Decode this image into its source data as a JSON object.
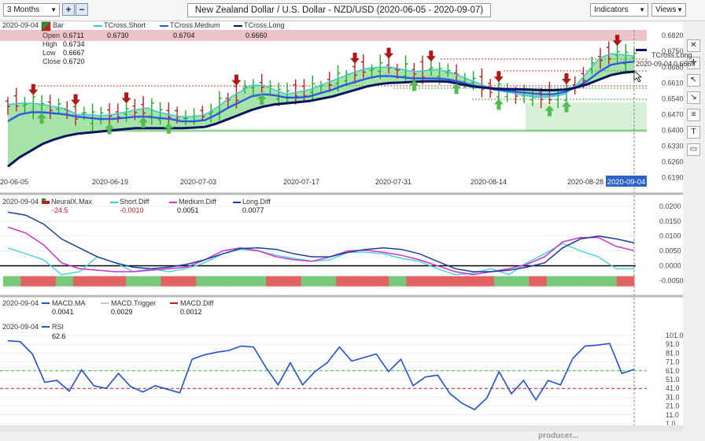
{
  "toolbar": {
    "period": "3 Months",
    "add_label": "+",
    "remove_label": "−",
    "title": "New Zealand Dollar / U.S. Dollar - NZD/USD (2020-06-05 - 2020-09-07)",
    "indicators_label": "Indicators",
    "views_label": "Views"
  },
  "colors": {
    "bull": "#22aa22",
    "bear": "#c02020",
    "short": "#3cc7d7",
    "medium": "#2a55e0",
    "long": "#0a1560",
    "macd_trigger": "#c8c8c8",
    "macd_diff": "#c02020",
    "rsi": "#2050d0",
    "rsi_upper": "#33bb33",
    "rsi_lower": "#cc2222",
    "zero": "#000000",
    "neural_pos": "#72c472",
    "neural_neg": "#e05a5a"
  },
  "price_panel": {
    "date": "2020-09-04",
    "bar_label": "Bar",
    "ohlc": [
      {
        "k": "Open",
        "v": "0.6711"
      },
      {
        "k": "High",
        "v": "0.6734"
      },
      {
        "k": "Low",
        "v": "0.6667"
      },
      {
        "k": "Close",
        "v": "0.6720"
      }
    ],
    "tcross": [
      {
        "k": "TCross.Short",
        "v": "0.6730"
      },
      {
        "k": "TCross.Medium",
        "v": "0.6704"
      },
      {
        "k": "TCross.Long",
        "v": "0.6660"
      }
    ],
    "tooltip_label": "TCross.Long",
    "tooltip_date": "2020-09-04",
    "tooltip_value": "0.6660",
    "current_date_tag": "2020-09-04"
  },
  "diff_panel": {
    "date": "2020-09-04",
    "items": [
      {
        "k": "NeuralX.Max",
        "v": "-24.5"
      },
      {
        "k": "Short.Diff",
        "v": "-0.0010"
      },
      {
        "k": "Medium.Diff",
        "v": "0.0051"
      },
      {
        "k": "Long.Diff",
        "v": "0.0077"
      }
    ]
  },
  "macd_panel": {
    "date": "2020-09-04",
    "items": [
      {
        "k": "MACD.MA",
        "v": "0.0041"
      },
      {
        "k": "MACD.Trigger",
        "v": "0.0029"
      },
      {
        "k": "MACD.Diff",
        "v": "0.0012"
      }
    ]
  },
  "rsi_panel": {
    "date": "2020-09-04",
    "items": [
      {
        "k": "RSI",
        "v": "62.6"
      }
    ]
  },
  "brand_text": "producer...",
  "chart_data": [
    {
      "type": "line",
      "panel": "price",
      "x_dates": [
        "2020-06-05",
        "2020-06-19",
        "2020-07-03",
        "2020-07-17",
        "2020-07-31",
        "2020-08-14",
        "2020-08-28",
        "2020-09-04"
      ],
      "x_tick_labels": [
        "20-06-05",
        "2020-06-19",
        "2020-07-03",
        "2020-07-17",
        "2020-07-31",
        "2020-08-14",
        "2020-08-28"
      ],
      "y_ticks": [
        "0.6820",
        "0.6750",
        "0.6680",
        "0.6610",
        "0.6540",
        "0.6470",
        "0.6400",
        "0.6330",
        "0.6260",
        "0.6190"
      ],
      "ylim": [
        0.6175,
        0.6845
      ],
      "series": [
        {
          "name": "TCross.Short",
          "values": [
            0.6515,
            0.652,
            0.652,
            0.6515,
            0.6505,
            0.6495,
            0.647,
            0.647,
            0.6465,
            0.647,
            0.648,
            0.649,
            0.65,
            0.648,
            0.647,
            0.646,
            0.646,
            0.647,
            0.65,
            0.654,
            0.657,
            0.66,
            0.66,
            0.658,
            0.656,
            0.657,
            0.658,
            0.66,
            0.662,
            0.664,
            0.666,
            0.6675,
            0.668,
            0.668,
            0.667,
            0.666,
            0.6665,
            0.667,
            0.666,
            0.664,
            0.662,
            0.66,
            0.658,
            0.657,
            0.656,
            0.655,
            0.6545,
            0.655,
            0.656,
            0.66,
            0.666,
            0.672,
            0.674,
            0.6735,
            0.673
          ]
        },
        {
          "name": "TCross.Medium",
          "values": [
            0.644,
            0.647,
            0.648,
            0.648,
            0.6475,
            0.647,
            0.646,
            0.6455,
            0.645,
            0.645,
            0.6455,
            0.646,
            0.646,
            0.6455,
            0.645,
            0.644,
            0.644,
            0.6445,
            0.647,
            0.65,
            0.6525,
            0.655,
            0.656,
            0.6555,
            0.6545,
            0.6545,
            0.655,
            0.6565,
            0.658,
            0.66,
            0.6615,
            0.663,
            0.664,
            0.664,
            0.6635,
            0.663,
            0.663,
            0.663,
            0.6625,
            0.6615,
            0.66,
            0.659,
            0.658,
            0.6575,
            0.657,
            0.6565,
            0.656,
            0.656,
            0.657,
            0.659,
            0.662,
            0.666,
            0.669,
            0.67,
            0.6704
          ]
        },
        {
          "name": "TCross.Long",
          "values": [
            0.624,
            0.628,
            0.631,
            0.634,
            0.636,
            0.6375,
            0.6385,
            0.639,
            0.6395,
            0.64,
            0.6405,
            0.641,
            0.641,
            0.641,
            0.641,
            0.641,
            0.6412,
            0.6415,
            0.643,
            0.645,
            0.647,
            0.649,
            0.6505,
            0.6515,
            0.652,
            0.6525,
            0.653,
            0.654,
            0.655,
            0.6565,
            0.658,
            0.6595,
            0.6605,
            0.661,
            0.6612,
            0.6615,
            0.6617,
            0.6618,
            0.6615,
            0.6605,
            0.6595,
            0.659,
            0.6585,
            0.6583,
            0.6582,
            0.658,
            0.6578,
            0.6578,
            0.658,
            0.659,
            0.6605,
            0.6625,
            0.6645,
            0.6655,
            0.666
          ]
        }
      ],
      "bull_arrow_x": [
        4,
        12,
        16,
        19,
        30,
        48,
        53,
        58,
        64,
        66
      ],
      "bear_arrow_x": [
        3,
        8,
        14,
        27,
        41,
        45,
        50,
        58,
        66,
        72
      ]
    },
    {
      "type": "line",
      "panel": "diff",
      "y_ticks": [
        "0.0200",
        "0.0150",
        "0.0100",
        "0.0050",
        "0.0000",
        "-0.0050"
      ],
      "ylim": [
        -0.0065,
        0.0205
      ],
      "series": [
        {
          "name": "Short.Diff",
          "values": [
            0.006,
            0.004,
            0.002,
            -0.003,
            -0.002,
            0.003,
            0.001,
            -0.002,
            -0.001,
            -0.002,
            -0.001,
            0.001,
            0.004,
            0.0055,
            0.005,
            0.0035,
            0.0025,
            0.0015,
            0.002,
            0.0045,
            0.0045,
            0.004,
            0.0025,
            0.0015,
            -0.001,
            -0.003,
            -0.0025,
            -0.001,
            -0.003,
            0.001,
            0.004,
            0.0075,
            0.005,
            0.003,
            -0.001,
            -0.001
          ]
        },
        {
          "name": "Medium.Diff",
          "values": [
            0.013,
            0.011,
            0.007,
            0.001,
            -0.001,
            -0.0015,
            -0.002,
            -0.002,
            -0.0015,
            -0.001,
            -0.0005,
            0.002,
            0.005,
            0.006,
            0.005,
            0.003,
            0.002,
            0.0015,
            0.003,
            0.005,
            0.0052,
            0.0045,
            0.0035,
            0.002,
            0.0,
            -0.002,
            -0.003,
            -0.002,
            -0.001,
            0.0005,
            0.003,
            0.008,
            0.0095,
            0.0095,
            0.0065,
            0.0051
          ]
        },
        {
          "name": "Long.Diff",
          "values": [
            0.018,
            0.017,
            0.014,
            0.009,
            0.006,
            0.003,
            0.001,
            -0.0005,
            -0.001,
            -0.0005,
            0.0005,
            0.002,
            0.004,
            0.0058,
            0.006,
            0.0055,
            0.004,
            0.003,
            0.003,
            0.0045,
            0.0055,
            0.006,
            0.0055,
            0.004,
            0.0015,
            -0.001,
            -0.002,
            -0.002,
            -0.0015,
            -0.0005,
            0.001,
            0.006,
            0.009,
            0.01,
            0.009,
            0.0077
          ]
        }
      ],
      "neural_signs": [
        1,
        -1,
        -1,
        1,
        -1,
        -1,
        -1,
        1,
        1,
        -1,
        -1,
        1,
        1,
        1,
        1,
        -1,
        -1,
        1,
        1,
        -1,
        -1,
        -1,
        1,
        -1,
        -1,
        -1,
        -1,
        -1,
        1,
        1,
        -1,
        1,
        1,
        1,
        1,
        -1
      ]
    },
    {
      "type": "line",
      "panel": "macd",
      "series": [
        {
          "name": "MACD.MA"
        },
        {
          "name": "MACD.Trigger"
        },
        {
          "name": "MACD.Diff"
        }
      ]
    },
    {
      "type": "line",
      "panel": "rsi",
      "y_ticks": [
        "101.0",
        "91.0",
        "81.0",
        "71.0",
        "61.0",
        "51.0",
        "41.0",
        "31.0",
        "21.0",
        "11.0",
        "1.0"
      ],
      "ylim": [
        1,
        101
      ],
      "upper_level": 61,
      "lower_level": 41,
      "series": [
        {
          "name": "RSI",
          "values": [
            95,
            94,
            80,
            48,
            50,
            38,
            62,
            44,
            41,
            58,
            43,
            37,
            44,
            40,
            36,
            74,
            79,
            82,
            84,
            89,
            88,
            65,
            45,
            70,
            45,
            60,
            70,
            88,
            72,
            76,
            80,
            60,
            74,
            44,
            54,
            56,
            35,
            24,
            17,
            30,
            60,
            35,
            50,
            28,
            50,
            45,
            75,
            89,
            90,
            92,
            58,
            62.6
          ]
        }
      ]
    }
  ]
}
